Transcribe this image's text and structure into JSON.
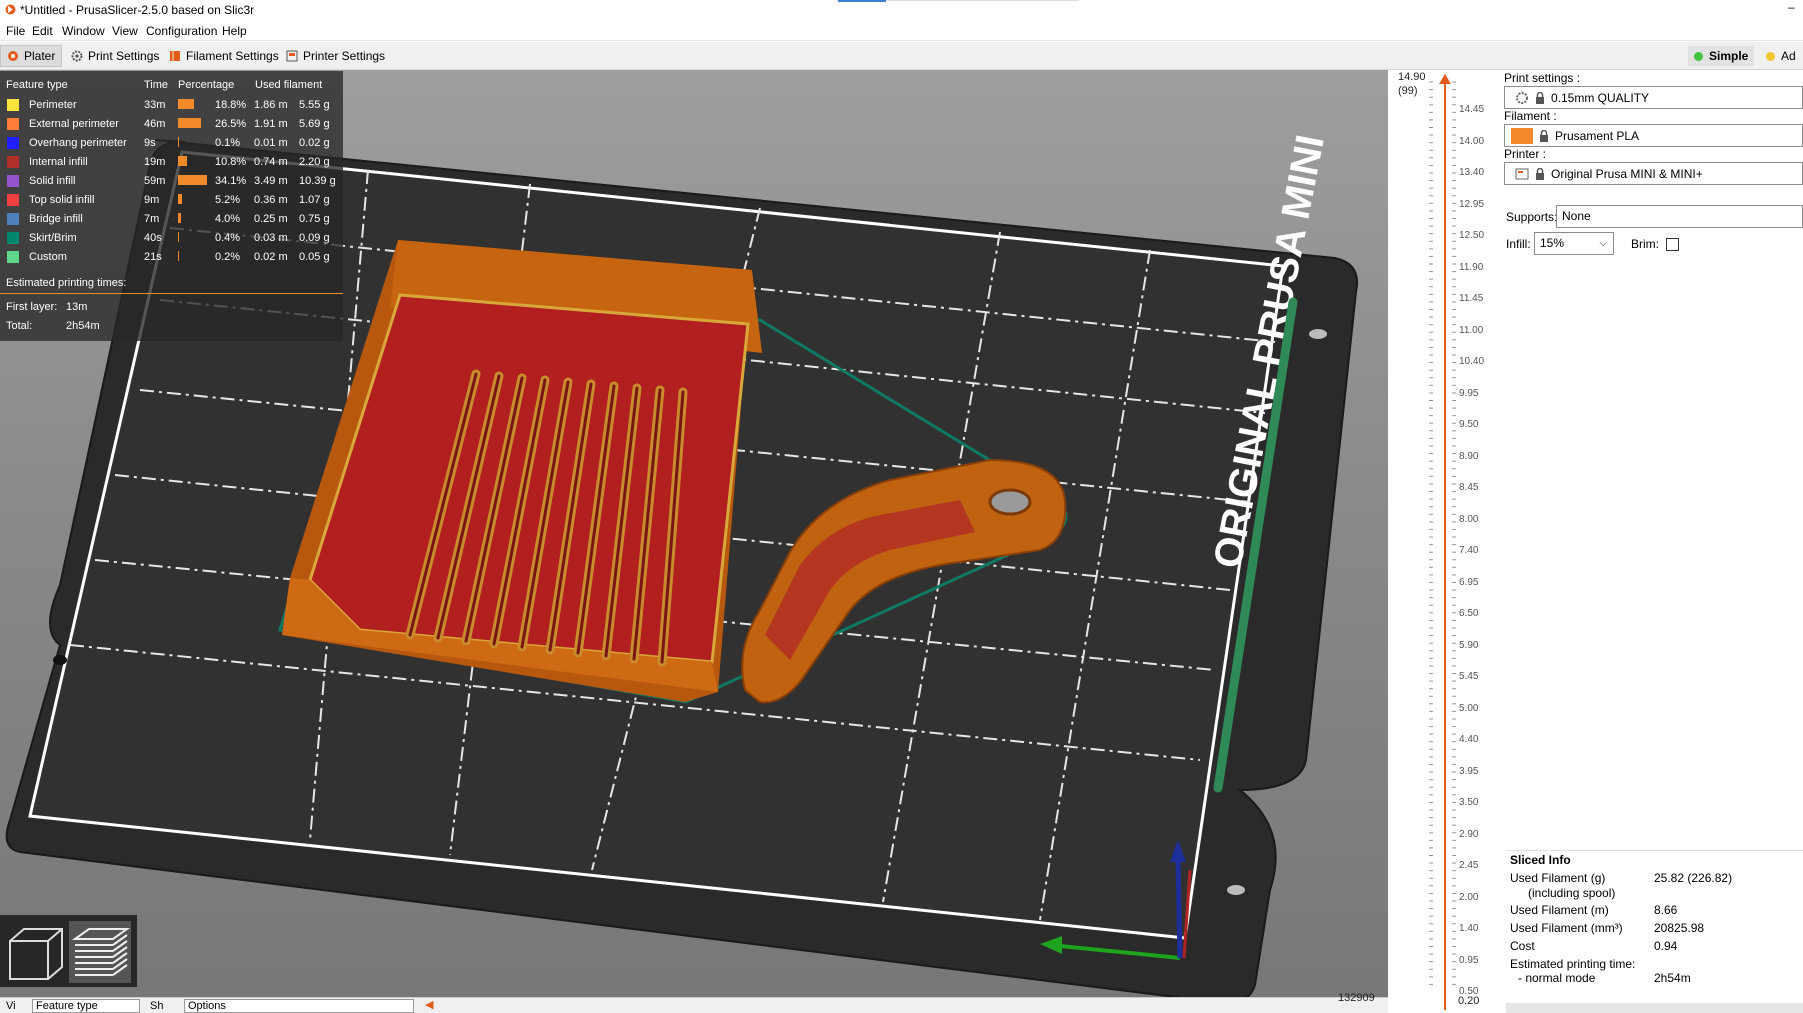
{
  "window": {
    "title": "*Untitled - PrusaSlicer-2.5.0 based on Slic3r",
    "app_icon": "prusaslicer-logo-icon",
    "minimize_glyph": "–"
  },
  "menu": [
    "File",
    "Edit",
    "Window",
    "View",
    "Configuration",
    "Help"
  ],
  "tabs": [
    {
      "label": "Plater",
      "icon": "plater-icon",
      "active": true
    },
    {
      "label": "Print Settings",
      "icon": "gear-icon",
      "active": false
    },
    {
      "label": "Filament Settings",
      "icon": "spool-icon",
      "active": false
    },
    {
      "label": "Printer Settings",
      "icon": "printer-icon",
      "active": false
    }
  ],
  "modes": [
    {
      "label": "Simple",
      "color": "#3ec33a",
      "active": true
    },
    {
      "label": "Ad",
      "color": "#f2c52c",
      "active": false
    }
  ],
  "legend": {
    "headers": [
      "Feature type",
      "Time",
      "Percentage",
      "Used filament"
    ],
    "rows": [
      {
        "name": "Perimeter",
        "color": "#ffe63f",
        "time": "33m",
        "percent": "18.8%",
        "pct_value": 18.8,
        "length": "1.86 m",
        "weight": "5.55 g"
      },
      {
        "name": "External perimeter",
        "color": "#ff7d38",
        "time": "46m",
        "percent": "26.5%",
        "pct_value": 26.5,
        "length": "1.91 m",
        "weight": "5.69 g"
      },
      {
        "name": "Overhang perimeter",
        "color": "#1f1fff",
        "time": "9s",
        "percent": "0.1%",
        "pct_value": 0.1,
        "length": "0.01 m",
        "weight": "0.02 g"
      },
      {
        "name": "Internal infill",
        "color": "#b03029",
        "time": "19m",
        "percent": "10.8%",
        "pct_value": 10.8,
        "length": "0.74 m",
        "weight": "2.20 g"
      },
      {
        "name": "Solid infill",
        "color": "#9654cc",
        "time": "59m",
        "percent": "34.1%",
        "pct_value": 34.1,
        "length": "3.49 m",
        "weight": "10.39 g"
      },
      {
        "name": "Top solid infill",
        "color": "#f04040",
        "time": "9m",
        "percent": "5.2%",
        "pct_value": 5.2,
        "length": "0.36 m",
        "weight": "1.07 g"
      },
      {
        "name": "Bridge infill",
        "color": "#4d80ba",
        "time": "7m",
        "percent": "4.0%",
        "pct_value": 4.0,
        "length": "0.25 m",
        "weight": "0.75 g"
      },
      {
        "name": "Skirt/Brim",
        "color": "#00876e",
        "time": "40s",
        "percent": "0.4%",
        "pct_value": 0.4,
        "length": "0.03 m",
        "weight": "0.09 g"
      },
      {
        "name": "Custom",
        "color": "#5ed78b",
        "time": "21s",
        "percent": "0.2%",
        "pct_value": 0.2,
        "length": "0.02 m",
        "weight": "0.05 g"
      }
    ],
    "estimated_title": "Estimated printing times:",
    "first_layer_label": "First layer:",
    "first_layer_value": "13m",
    "total_label": "Total:",
    "total_value": "2h54m"
  },
  "bed_label": "ORIGINAL PRUSA MINI",
  "view_toggles": [
    {
      "name": "3d-view-cube-icon"
    },
    {
      "name": "layers-preview-icon"
    }
  ],
  "bottom_strip": {
    "view_label": "Vi",
    "view_value": "Feature type",
    "show_label": "Sh",
    "show_value": "Options"
  },
  "ruler": {
    "top_value": "14.90",
    "top_layer": "(99)",
    "ticks": [
      "14.45",
      "14.00",
      "13.40",
      "12.95",
      "12.50",
      "11.90",
      "11.45",
      "11.00",
      "10.40",
      "9.95",
      "9.50",
      "8.90",
      "8.45",
      "8.00",
      "7.40",
      "6.95",
      "6.50",
      "5.90",
      "5.45",
      "5.00",
      "4.40",
      "3.95",
      "3.50",
      "2.90",
      "2.45",
      "2.00",
      "1.40",
      "0.95",
      "0.50"
    ],
    "bottom_value": "0.20",
    "horizontal_moves": "132909"
  },
  "sidebar": {
    "print_settings_label": "Print settings :",
    "print_settings_value": "0.15mm QUALITY",
    "filament_label": "Filament :",
    "filament_value": "Prusament PLA",
    "filament_color": "#f28a2c",
    "printer_label": "Printer :",
    "printer_value": "Original Prusa MINI & MINI+",
    "supports_label": "Supports:",
    "supports_value": "None",
    "infill_label": "Infill:",
    "infill_value": "15%",
    "brim_label": "Brim:",
    "brim_checked": false
  },
  "sliced_info": {
    "title": "Sliced Info",
    "rows": [
      {
        "key": "Used Filament (g)",
        "value": "25.82 (226.82)"
      },
      {
        "key": "(including spool)",
        "value": ""
      },
      {
        "key": "Used Filament (m)",
        "value": "8.66"
      },
      {
        "key": "Used Filament (mm³)",
        "value": "20825.98"
      },
      {
        "key": "Cost",
        "value": "0.94"
      },
      {
        "key": "Estimated printing time:",
        "value": ""
      },
      {
        "key": "- normal mode",
        "value": "2h54m"
      }
    ]
  }
}
